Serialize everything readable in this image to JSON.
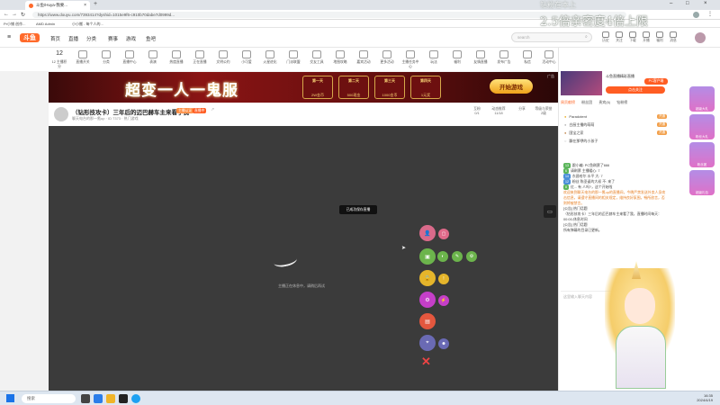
{
  "browser": {
    "tab_title": "斗鱼/Huya-我要...",
    "url": "https://www.douyu.com/7393414?dyshid=1015e9f6-c910b70dabe7d0999d...",
    "bookmarks": [
      "Pr小铺 创作...",
      "AMD Admin",
      "小小搬 - 每个人的..."
    ]
  },
  "site": {
    "logo": "斗鱼",
    "nav": [
      "首页",
      "直播",
      "分类",
      "赛事",
      "游戏",
      "鱼吧"
    ],
    "search_placeholder": "search",
    "top_icons": [
      "历史",
      "关注",
      "下载",
      "开播",
      "福利",
      "消息"
    ],
    "category_items": [
      "12 主播积分",
      "直播开关",
      "分类",
      "直播中心",
      "表演",
      "热度直播",
      "正在直播",
      "文明公约",
      "小可爱",
      "火星进化",
      "门派联盟",
      "交友工具",
      "地图攻略",
      "嘉宾活动",
      "更多活动",
      "主播任务中心",
      "玩法",
      "福利",
      "友情直播",
      "发布广告",
      "私信",
      "活动中心",
      "精彩剪辑",
      "你好生活"
    ]
  },
  "banner": {
    "title": "超变一人一鬼服",
    "prizes": [
      {
        "day": "第一天",
        "amt": "2W金币"
      },
      {
        "day": "第二天",
        "amt": "500现金"
      },
      {
        "day": "第三天",
        "amt": "1000金币"
      },
      {
        "day": "第四天",
        "amt": "1元奖"
      }
    ],
    "start_label": "开始游戏",
    "ad_label": "广告"
  },
  "room": {
    "title": "（钻形技攻卡）三年后的迈巴赫车主来看了我",
    "tags": [
      "主播认证",
      "直播中"
    ],
    "subtitle": "聊天电台的那一氪up  ·  ID 7373  ·  热门游戏",
    "stats": [
      "互粉",
      "动态推荐",
      "分享",
      "等级与荣誉"
    ]
  },
  "player": {
    "tooltip": "已成功保存直播",
    "loading_text": "主播正在休息中，请稍后再试"
  },
  "sidebar": {
    "anchor_name": "斗鱼直播精彩直播",
    "follow_label": "点击关注",
    "pc_label": "PC客户端",
    "tabs": [
      "周贡献榜",
      "粉丝团",
      "贵宾(6)",
      "钻粉榜"
    ],
    "rank_rows": [
      "Paradotent",
      "白厨主播的萌萌",
      "国宝之家",
      "飘在那咿的小孩子"
    ],
    "chat": [
      {
        "lv": "13",
        "text": "跟小编: PC鱼刷票了666"
      },
      {
        "lv": "6",
        "text": "请刷票 主播暖心: 7"
      },
      {
        "lv": "14",
        "text": "东昌哈尔 水平 大: 7"
      },
      {
        "lv": "12",
        "text": "粉丝 陈圣诞的大叔 不: 来了"
      },
      {
        "lv": "8",
        "text": "红... 有 人吗?，这个开始啦"
      },
      {
        "lv": "sys",
        "text": "欢迎来到聊天电台的那一氪up的直播间，今晚严禁发送外卖人身攻击信息，请遵守直播间的相关规定，维持良好氛围，畅所欲言，否则将被禁言。"
      },
      {
        "lv": "sys",
        "text": "[公告] 热门话题"
      },
      {
        "lv": "sys",
        "text": "（钻形技攻卡）三年后的迈巴赫车主来看了我，直播时间每天：00:00-休息时间"
      },
      {
        "lv": "sys",
        "text": "[公告] 热门话题"
      },
      {
        "lv": "sys",
        "text": "所有弹幕的目录已更新。"
      }
    ],
    "chat_input_placeholder": "这里输入聊天内容"
  },
  "overlay": {
    "line1": "钻粉在本上",
    "line2": "2.5倍亲密度4倍上限"
  },
  "gifts": [
    "超级大礼",
    "粉丝大礼",
    "粉丝团",
    "超级礼包"
  ],
  "taskbar": {
    "search_label": "搜索",
    "time": "16:35",
    "date": "2024/4/19"
  }
}
